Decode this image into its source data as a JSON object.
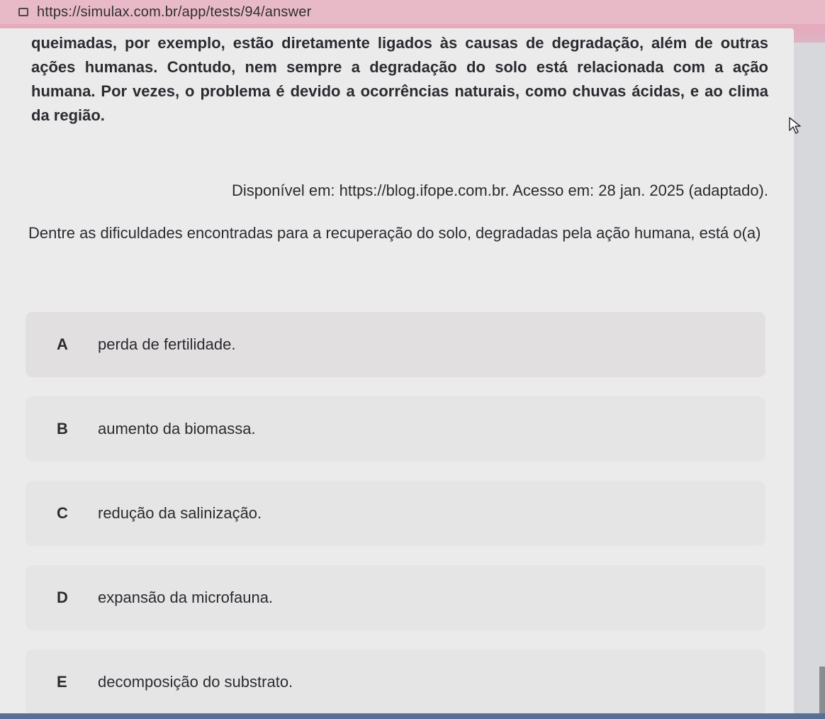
{
  "browser": {
    "url": "https://simulax.com.br/app/tests/94/answer",
    "page_icon": "page-icon"
  },
  "passage": {
    "text": "queimadas, por exemplo, estão diretamente ligados às causas de degradação, além de outras ações humanas. Contudo, nem sempre a degradação do solo está relacionada com a ação humana. Por vezes, o problema é devido a ocorrências naturais, como chuvas ácidas, e ao clima da região."
  },
  "source": {
    "text": "Disponível em: https://blog.ifope.com.br. Acesso em: 28 jan. 2025 (adaptado)."
  },
  "question": {
    "text": "Dentre as dificuldades encontradas para a recuperação do solo, degradadas pela ação humana, está o(a)"
  },
  "options": [
    {
      "letter": "A",
      "text": "perda de fertilidade."
    },
    {
      "letter": "B",
      "text": "aumento da biomassa."
    },
    {
      "letter": "C",
      "text": "redução da salinização."
    },
    {
      "letter": "D",
      "text": "expansão da microfauna."
    },
    {
      "letter": "E",
      "text": "decomposição do substrato."
    }
  ],
  "colors": {
    "address_bar": "#e8b9c6",
    "text": "#2b2b30",
    "bottom_bar": "#5a6f96"
  }
}
